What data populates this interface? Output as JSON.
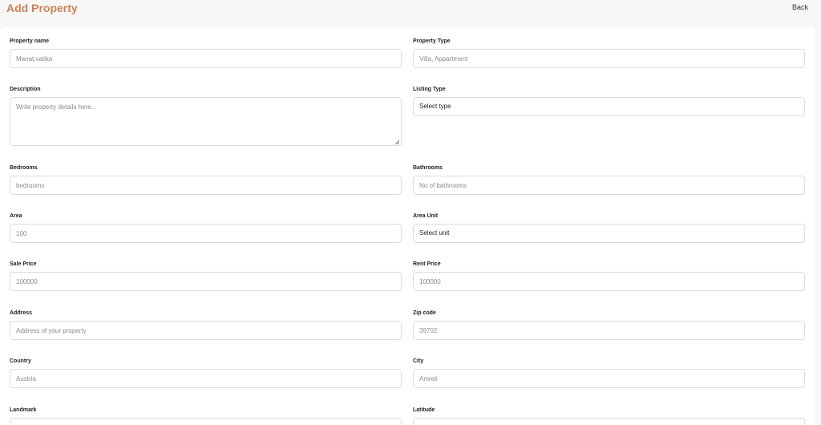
{
  "header": {
    "title": "Add Property",
    "back_label": "Back"
  },
  "form": {
    "property_name": {
      "label": "Property name",
      "placeholder": "Manat,vatika"
    },
    "property_type": {
      "label": "Property Type",
      "placeholder": "Villa, Appartment"
    },
    "description": {
      "label": "Description",
      "placeholder": "Write property details here..."
    },
    "listing_type": {
      "label": "Listing Type",
      "value": "Select type"
    },
    "bedrooms": {
      "label": "Bedrooms",
      "placeholder": "bedrooms"
    },
    "bathrooms": {
      "label": "Bathrooms",
      "placeholder": "No of bathrooms"
    },
    "area": {
      "label": "Area",
      "placeholder": "100"
    },
    "area_unit": {
      "label": "Area Unit",
      "value": "Select unit"
    },
    "sale_price": {
      "label": "Sale Price",
      "placeholder": "100000"
    },
    "rent_price": {
      "label": "Rent Price",
      "placeholder": "100000"
    },
    "address": {
      "label": "Address",
      "placeholder": "Address of your property"
    },
    "zip_code": {
      "label": "Zip code",
      "placeholder": "39702"
    },
    "country": {
      "label": "Country",
      "placeholder": "Austria"
    },
    "city": {
      "label": "City",
      "placeholder": "Amreli"
    },
    "landmark": {
      "label": "Landmark"
    },
    "latitude": {
      "label": "Latitude"
    }
  }
}
